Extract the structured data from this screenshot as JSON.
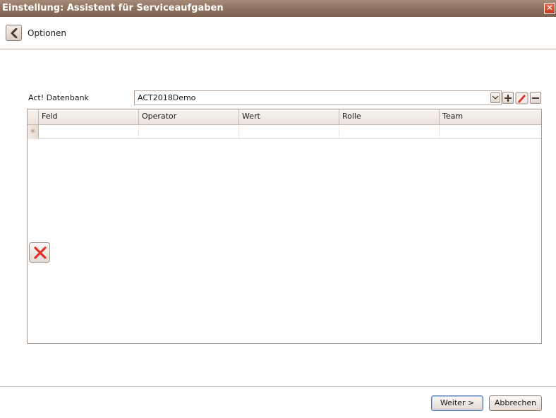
{
  "window": {
    "title": "Einstellung: Assistent für Serviceaufgaben",
    "close_glyph": "✕"
  },
  "nav": {
    "back_icon": "chevron-left-icon",
    "title": "Optionen"
  },
  "database": {
    "label": "Act! Datenbank",
    "selected": "ACT2018Demo"
  },
  "grid": {
    "columns": [
      "Feld",
      "Operator",
      "Wert",
      "Rolle",
      "Team"
    ],
    "new_row_glyph": "✳"
  },
  "footer": {
    "next_label": "Weiter >",
    "cancel_label": "Abbrechen"
  },
  "colors": {
    "titlebar": "#8c6f5c",
    "accent_red": "#e0302a"
  }
}
